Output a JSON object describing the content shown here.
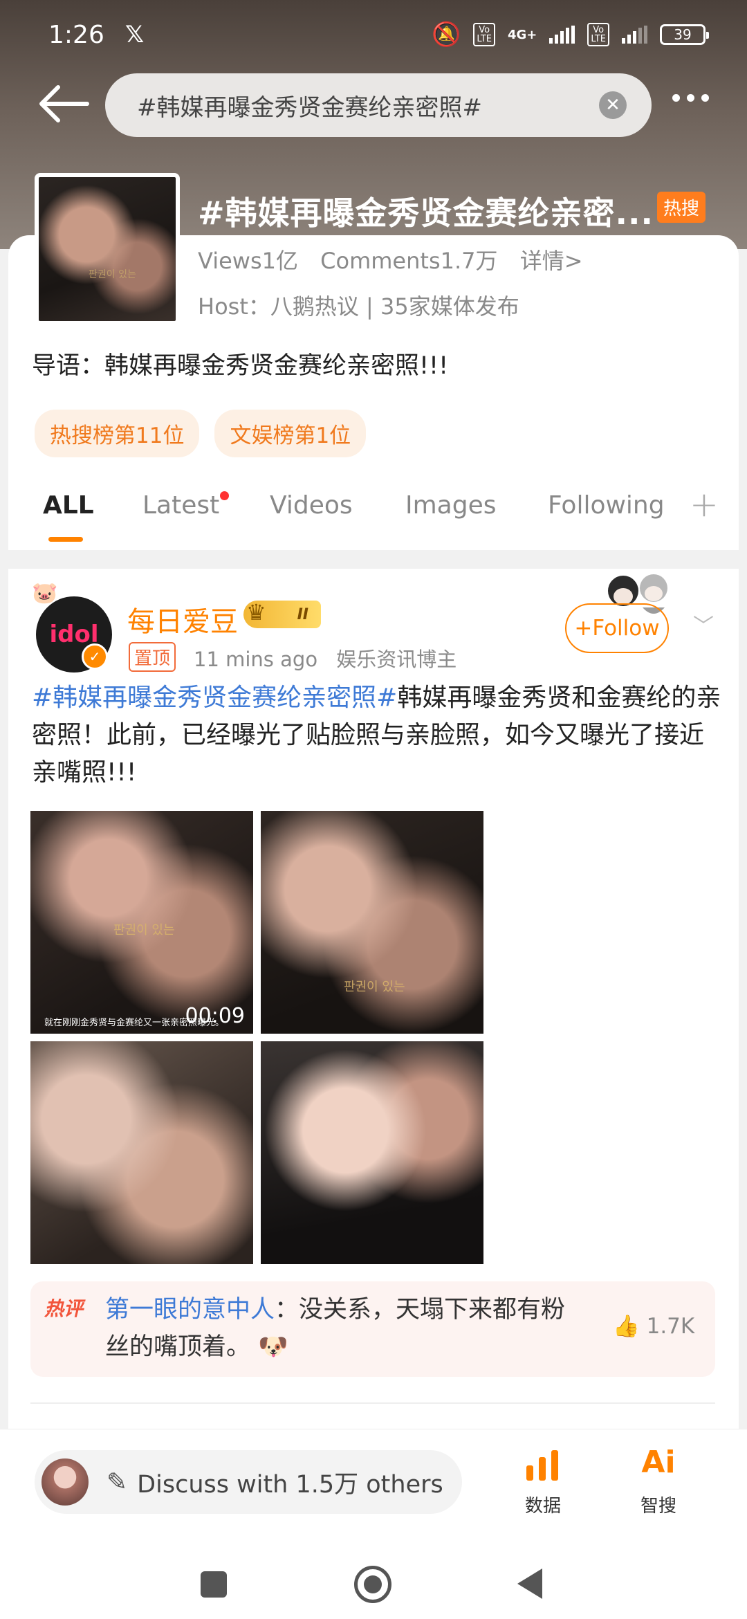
{
  "status_bar": {
    "time": "1:26",
    "app_icon": "x-icon",
    "battery": "39",
    "network_label": "4G+",
    "volte": "Vo LTE"
  },
  "search": {
    "query": "#韩媒再曝金秀贤金赛纶亲密照#"
  },
  "topic": {
    "title": "#韩媒再曝金秀贤金赛纶亲密...",
    "badge": "热搜",
    "views": "Views1亿",
    "comments": "Comments1.7万",
    "details": "详情>",
    "host": "Host：八鹅热议 | 35家媒体发布",
    "guide": "导语：韩媒再曝金秀贤金赛纶亲密照!!!",
    "tags": [
      "热搜榜第11位",
      "文娱榜第1位"
    ],
    "cover_watermark": "판권이 있는"
  },
  "tabs": [
    "ALL",
    "Latest",
    "Videos",
    "Images",
    "Following"
  ],
  "post": {
    "username": "每日爱豆",
    "level": "II",
    "pinned": "置顶",
    "time": "11 mins ago",
    "role": "娱乐资讯博主",
    "follow": "+Follow",
    "avatar_text": "idol",
    "text_hashtag": "#韩媒再曝金秀贤金赛纶亲密照#",
    "text_body": "韩媒再曝金秀贤和金赛纶的亲密照！此前，已经曝光了贴脸照与亲脸照，如今又曝光了接近亲嘴照!!!",
    "images": [
      {
        "watermark": "판권이 있는",
        "subtitle": "就在刚刚金秀贤与金赛纶又一张亲密照曝光。",
        "duration": "00:09"
      },
      {
        "watermark": "판권이 있는"
      },
      {},
      {}
    ],
    "hot_comment": {
      "label": "热评",
      "user": "第一眼的意中人",
      "text": "：没关系，天塌下来都有粉丝的嘴顶着。",
      "likes": "1.7K"
    }
  },
  "bottom": {
    "discuss": "Discuss with 1.5万 others",
    "data_label": "数据",
    "ai_label": "智搜",
    "ai_icon_text": "Ai"
  },
  "colors": {
    "accent": "#ff8200",
    "link": "#3e7ad6",
    "hot": "#ff7d1d"
  }
}
